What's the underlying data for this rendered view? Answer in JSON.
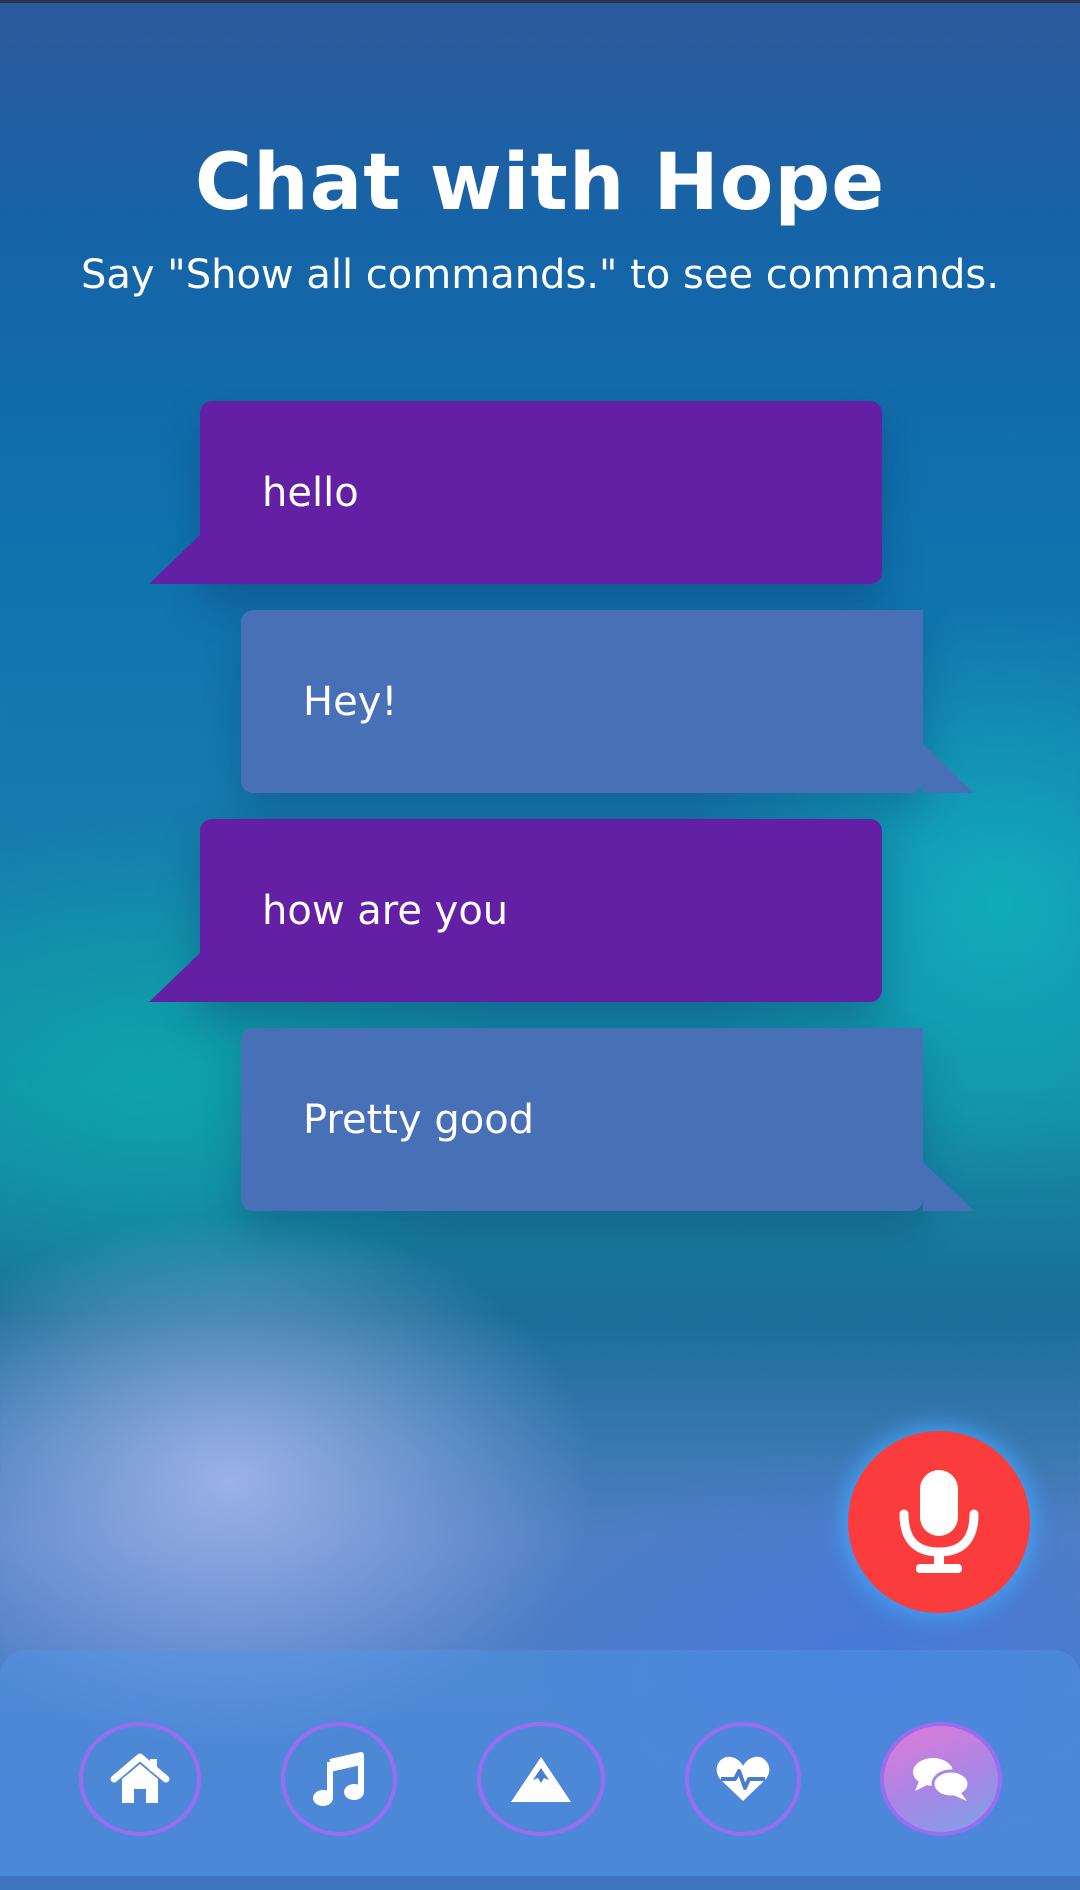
{
  "header": {
    "title": "Chat with Hope",
    "subtitle": "Say \"Show all commands.\" to see commands."
  },
  "messages": [
    {
      "from": "user",
      "text": "hello"
    },
    {
      "from": "bot",
      "text": "Hey!"
    },
    {
      "from": "user",
      "text": "how are you"
    },
    {
      "from": "bot",
      "text": "Pretty good"
    }
  ],
  "mic": {
    "icon": "microphone-icon",
    "color": "#fa3c3d"
  },
  "nav": {
    "items": [
      {
        "icon": "home-icon",
        "active": false
      },
      {
        "icon": "music-note-icon",
        "active": false
      },
      {
        "icon": "mountain-icon",
        "active": false
      },
      {
        "icon": "heartbeat-icon",
        "active": false
      },
      {
        "icon": "chat-bubbles-icon",
        "active": true
      }
    ],
    "accent_color": "#9b6cf0"
  },
  "colors": {
    "user_bubble": "#6320a5",
    "bot_bubble": "#4870b7"
  }
}
